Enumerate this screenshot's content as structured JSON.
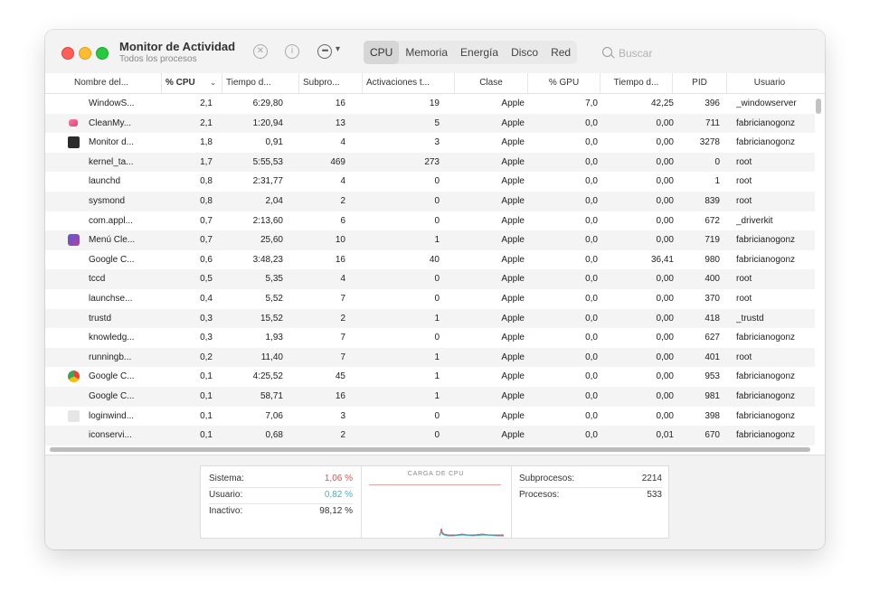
{
  "window": {
    "title": "Monitor de Actividad",
    "subtitle": "Todos los procesos"
  },
  "toolbar": {
    "tabs": [
      "CPU",
      "Memoria",
      "Energía",
      "Disco",
      "Red"
    ],
    "active_tab": "CPU",
    "search_placeholder": "Buscar"
  },
  "columns": [
    "Nombre del...",
    "% CPU",
    "Tiempo d...",
    "Subpro...",
    "Activaciones t...",
    "Clase",
    "% GPU",
    "Tiempo d...",
    "PID",
    "Usuario"
  ],
  "sorted_column": "% CPU",
  "rows": [
    {
      "icon": "none",
      "name": "WindowS...",
      "cpu": "2,1",
      "time": "6:29,80",
      "threads": "16",
      "wakeups": "19",
      "kind": "Apple",
      "gpu": "7,0",
      "gputime": "42,25",
      "pid": "396",
      "user": "_windowserver"
    },
    {
      "icon": "cleanmymac-icon",
      "name": "CleanMy...",
      "cpu": "2,1",
      "time": "1:20,94",
      "threads": "13",
      "wakeups": "5",
      "kind": "Apple",
      "gpu": "0,0",
      "gputime": "0,00",
      "pid": "711",
      "user": "fabricianogonz"
    },
    {
      "icon": "activity-monitor-icon",
      "name": "Monitor d...",
      "cpu": "1,8",
      "time": "0,91",
      "threads": "4",
      "wakeups": "3",
      "kind": "Apple",
      "gpu": "0,0",
      "gputime": "0,00",
      "pid": "3278",
      "user": "fabricianogonz"
    },
    {
      "icon": "none",
      "name": "kernel_ta...",
      "cpu": "1,7",
      "time": "5:55,53",
      "threads": "469",
      "wakeups": "273",
      "kind": "Apple",
      "gpu": "0,0",
      "gputime": "0,00",
      "pid": "0",
      "user": "root"
    },
    {
      "icon": "none",
      "name": "launchd",
      "cpu": "0,8",
      "time": "2:31,77",
      "threads": "4",
      "wakeups": "0",
      "kind": "Apple",
      "gpu": "0,0",
      "gputime": "0,00",
      "pid": "1",
      "user": "root"
    },
    {
      "icon": "none",
      "name": "sysmond",
      "cpu": "0,8",
      "time": "2,04",
      "threads": "2",
      "wakeups": "0",
      "kind": "Apple",
      "gpu": "0,0",
      "gputime": "0,00",
      "pid": "839",
      "user": "root"
    },
    {
      "icon": "none",
      "name": "com.appl...",
      "cpu": "0,7",
      "time": "2:13,60",
      "threads": "6",
      "wakeups": "0",
      "kind": "Apple",
      "gpu": "0,0",
      "gputime": "0,00",
      "pid": "672",
      "user": "_driverkit"
    },
    {
      "icon": "menu-cleaner-icon",
      "name": "Menú Cle...",
      "cpu": "0,7",
      "time": "25,60",
      "threads": "10",
      "wakeups": "1",
      "kind": "Apple",
      "gpu": "0,0",
      "gputime": "0,00",
      "pid": "719",
      "user": "fabricianogonz"
    },
    {
      "icon": "none",
      "name": "Google C...",
      "cpu": "0,6",
      "time": "3:48,23",
      "threads": "16",
      "wakeups": "40",
      "kind": "Apple",
      "gpu": "0,0",
      "gputime": "36,41",
      "pid": "980",
      "user": "fabricianogonz"
    },
    {
      "icon": "none",
      "name": "tccd",
      "cpu": "0,5",
      "time": "5,35",
      "threads": "4",
      "wakeups": "0",
      "kind": "Apple",
      "gpu": "0,0",
      "gputime": "0,00",
      "pid": "400",
      "user": "root"
    },
    {
      "icon": "none",
      "name": "launchse...",
      "cpu": "0,4",
      "time": "5,52",
      "threads": "7",
      "wakeups": "0",
      "kind": "Apple",
      "gpu": "0,0",
      "gputime": "0,00",
      "pid": "370",
      "user": "root"
    },
    {
      "icon": "none",
      "name": "trustd",
      "cpu": "0,3",
      "time": "15,52",
      "threads": "2",
      "wakeups": "1",
      "kind": "Apple",
      "gpu": "0,0",
      "gputime": "0,00",
      "pid": "418",
      "user": "_trustd"
    },
    {
      "icon": "none",
      "name": "knowledg...",
      "cpu": "0,3",
      "time": "1,93",
      "threads": "7",
      "wakeups": "0",
      "kind": "Apple",
      "gpu": "0,0",
      "gputime": "0,00",
      "pid": "627",
      "user": "fabricianogonz"
    },
    {
      "icon": "none",
      "name": "runningb...",
      "cpu": "0,2",
      "time": "11,40",
      "threads": "7",
      "wakeups": "1",
      "kind": "Apple",
      "gpu": "0,0",
      "gputime": "0,00",
      "pid": "401",
      "user": "root"
    },
    {
      "icon": "chrome-icon",
      "name": "Google C...",
      "cpu": "0,1",
      "time": "4:25,52",
      "threads": "45",
      "wakeups": "1",
      "kind": "Apple",
      "gpu": "0,0",
      "gputime": "0,00",
      "pid": "953",
      "user": "fabricianogonz"
    },
    {
      "icon": "none",
      "name": "Google C...",
      "cpu": "0,1",
      "time": "58,71",
      "threads": "16",
      "wakeups": "1",
      "kind": "Apple",
      "gpu": "0,0",
      "gputime": "0,00",
      "pid": "981",
      "user": "fabricianogonz"
    },
    {
      "icon": "login-window-icon",
      "name": "loginwind...",
      "cpu": "0,1",
      "time": "7,06",
      "threads": "3",
      "wakeups": "0",
      "kind": "Apple",
      "gpu": "0,0",
      "gputime": "0,00",
      "pid": "398",
      "user": "fabricianogonz"
    },
    {
      "icon": "none",
      "name": "iconservi...",
      "cpu": "0,1",
      "time": "0,68",
      "threads": "2",
      "wakeups": "0",
      "kind": "Apple",
      "gpu": "0,0",
      "gputime": "0,01",
      "pid": "670",
      "user": "fabricianogonz"
    }
  ],
  "summary": {
    "sistema_label": "Sistema:",
    "sistema_value": "1,06 %",
    "usuario_label": "Usuario:",
    "usuario_value": "0,82 %",
    "inactivo_label": "Inactivo:",
    "inactivo_value": "98,12 %",
    "chart_title": "CARGA DE CPU",
    "subprocesos_label": "Subprocesos:",
    "subprocesos_value": "2214",
    "procesos_label": "Procesos:",
    "procesos_value": "533"
  },
  "colors": {
    "sistema": "#e0443e",
    "usuario": "#3ab5c9",
    "close": "#ff5f57",
    "minimize": "#febc2e",
    "maximize": "#28c840"
  }
}
